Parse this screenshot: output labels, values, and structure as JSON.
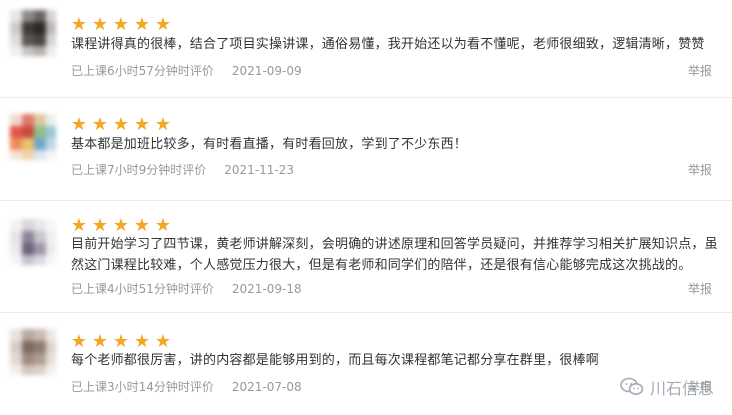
{
  "reviews": [
    {
      "stars": 5,
      "content": "课程讲得真的很棒，结合了项目实操讲课，通俗易懂，我开始还以为看不懂呢，老师很细致，逻辑清晰，赞赞",
      "meta_time": "已上课6小时57分钟时评价",
      "date": "2021-09-09",
      "report_label": "举报"
    },
    {
      "stars": 5,
      "content": "基本都是加班比较多，有时看直播，有时看回放，学到了不少东西！",
      "meta_time": "已上课7小时9分钟时评价",
      "date": "2021-11-23",
      "report_label": "举报"
    },
    {
      "stars": 5,
      "content": "目前开始学习了四节课，黄老师讲解深刻，会明确的讲述原理和回答学员疑问，并推荐学习相关扩展知识点，虽然这门课程比较难，个人感觉压力很大，但是有老师和同学们的陪伴，还是很有信心能够完成这次挑战的。",
      "meta_time": "已上课4小时51分钟时评价",
      "date": "2021-09-18",
      "report_label": "举报"
    },
    {
      "stars": 5,
      "content": "每个老师都很厉害，讲的内容都是能够用到的，而且每次课程都笔记都分享在群里，很棒啊",
      "meta_time": "已上课3小时14分钟时评价",
      "date": "2021-07-08",
      "report_label": "举报"
    }
  ],
  "watermark": {
    "text": "川石信息",
    "icon": "wechat-icon"
  },
  "colors": {
    "star": "#f5a623",
    "meta": "#999999",
    "text": "#333333",
    "divider": "#ececec"
  }
}
